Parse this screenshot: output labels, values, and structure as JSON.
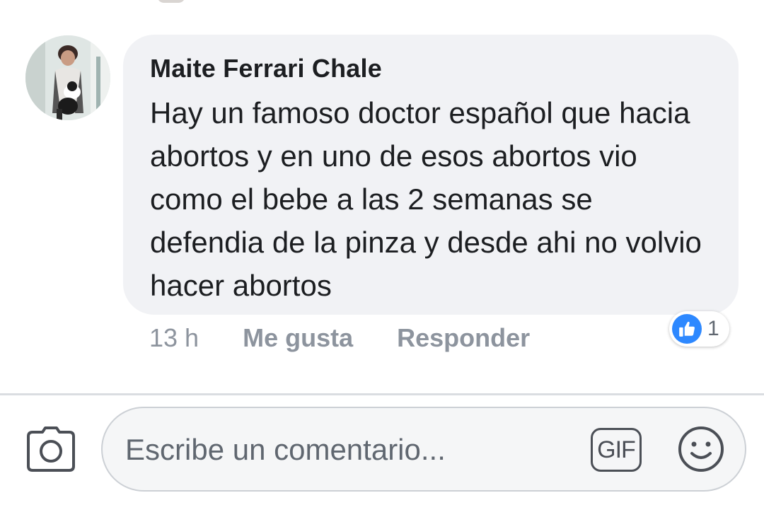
{
  "comment": {
    "author": "Maite Ferrari Chale",
    "text": "Hay un famoso doctor español que hacia abortos y en uno de esos abortos vio como el bebe a las 2 semanas se defendia de la pinza y desde ahi no volvio hacer abortos",
    "timestamp": "13 h",
    "like_label": "Me gusta",
    "reply_label": "Responder",
    "reaction_icon": "thumbs-up-icon",
    "reaction_count": "1"
  },
  "composer": {
    "placeholder": "Escribe un comentario...",
    "camera_icon": "camera-icon",
    "gif_label": "GIF",
    "emoji_icon": "smiley-icon"
  },
  "colors": {
    "bubble_bg": "#f1f2f5",
    "like_blue": "#2d88ff",
    "muted_text": "#8d949e",
    "text": "#1c1e21"
  }
}
